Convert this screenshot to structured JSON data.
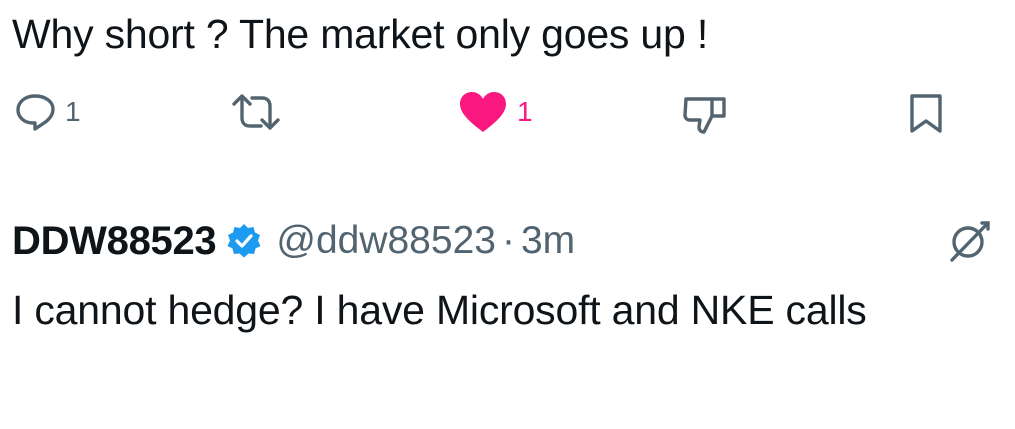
{
  "tweet": {
    "text": "Why short ? The market only goes up !",
    "actions": {
      "reply_count": "1",
      "like_count": "1"
    }
  },
  "reply": {
    "display_name": "DDW88523",
    "handle": "@ddw88523",
    "separator": "·",
    "timestamp": "3m",
    "text": "I cannot hedge? I have Microsoft and NKE calls"
  },
  "icons": {
    "reply": "reply-icon",
    "retweet": "retweet-icon",
    "like": "heart-filled-icon",
    "dislike": "dislike-icon",
    "bookmark": "bookmark-icon",
    "verified": "verified-badge-icon",
    "grok": "grok-icon"
  },
  "colors": {
    "text": "#0f1419",
    "muted": "#536471",
    "like": "#f91880",
    "verified": "#1d9bf0"
  }
}
